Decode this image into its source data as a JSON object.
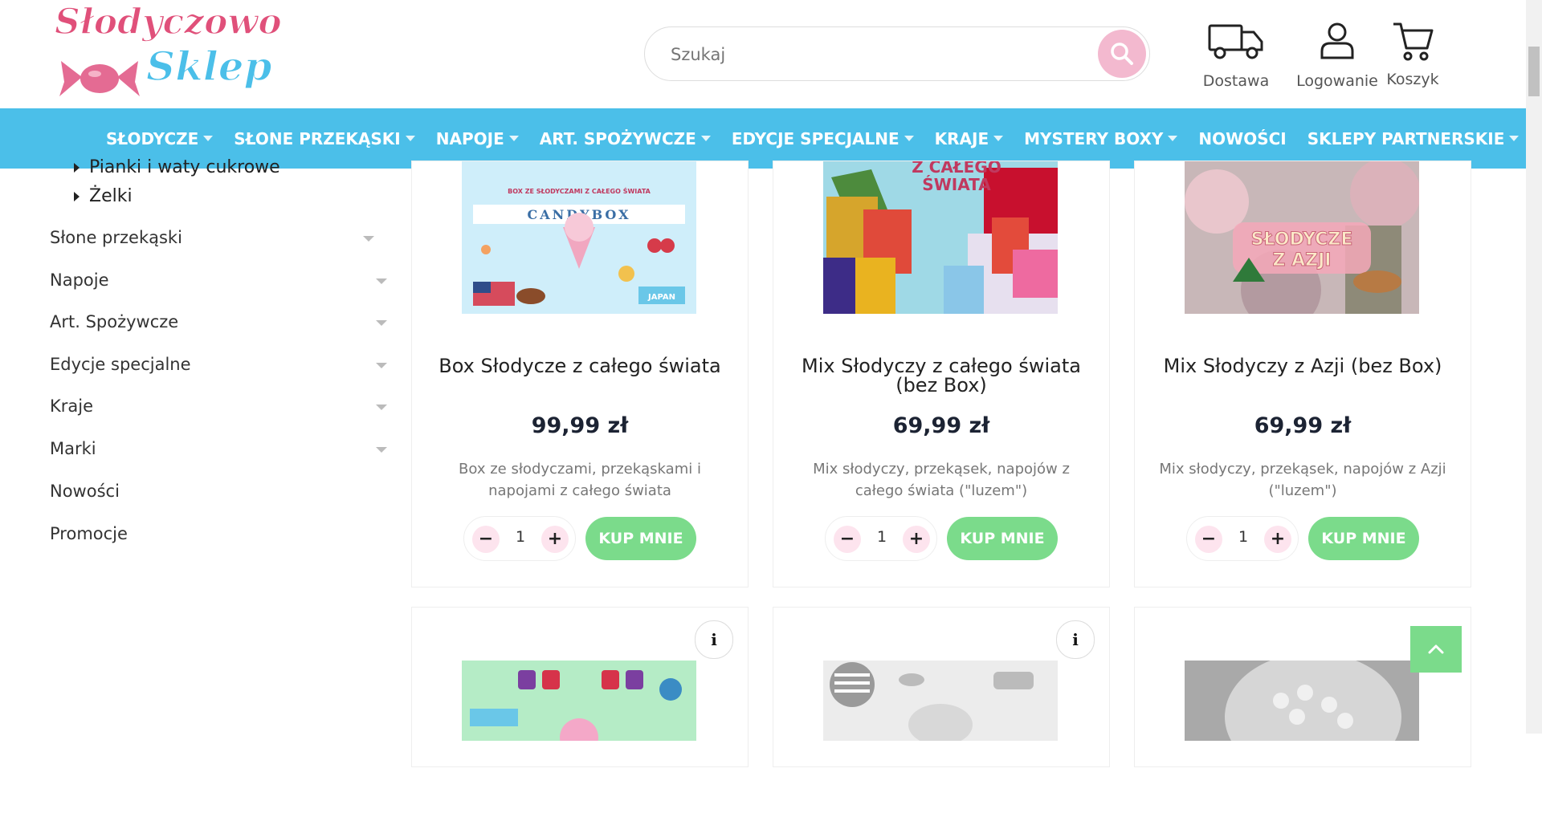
{
  "brand": {
    "line1": "Słodyczowo",
    "line2": "Sklep"
  },
  "search": {
    "placeholder": "Szukaj"
  },
  "header_icons": {
    "delivery": "Dostawa",
    "login": "Logowanie",
    "cart": "Koszyk"
  },
  "nav": [
    {
      "label": "SŁODYCZE",
      "caret": true
    },
    {
      "label": "SŁONE PRZEKĄSKI",
      "caret": true
    },
    {
      "label": "NAPOJE",
      "caret": true
    },
    {
      "label": "ART. SPOŻYWCZE",
      "caret": true
    },
    {
      "label": "EDYCJE SPECJALNE",
      "caret": true
    },
    {
      "label": "KRAJE",
      "caret": true
    },
    {
      "label": "MYSTERY BOXY",
      "caret": true
    },
    {
      "label": "NOWOŚCI",
      "caret": false
    },
    {
      "label": "SKLEPY PARTNERSKIE",
      "caret": true
    }
  ],
  "sidebar": {
    "subcategories": [
      "Pianki i waty cukrowe",
      "Żelki"
    ],
    "categories": [
      {
        "label": "Słone przekąski",
        "caret": true
      },
      {
        "label": "Napoje",
        "caret": true
      },
      {
        "label": "Art. Spożywcze",
        "caret": true
      },
      {
        "label": "Edycje specjalne",
        "caret": true
      },
      {
        "label": "Kraje",
        "caret": true
      },
      {
        "label": "Marki",
        "caret": true
      },
      {
        "label": "Nowości",
        "caret": false
      },
      {
        "label": "Promocje",
        "caret": false
      }
    ]
  },
  "products": [
    {
      "title": "Box Słodycze z całego świata",
      "price": "99,99 zł",
      "desc": "Box ze słodyczami, przekąskami i napojami z całego świata",
      "qty": "1",
      "buy": "KUP MNIE",
      "img_text1": "BOX ZE SŁODYCZAMI Z CAŁEGO ŚWIATA",
      "img_text2": "CANDYBOX",
      "img_text3": "JAPAN"
    },
    {
      "title": "Mix Słodyczy z całego świata (bez Box)",
      "price": "69,99 zł",
      "desc": "Mix słodyczy, przekąsek, napojów z całego świata (\"luzem\")",
      "qty": "1",
      "buy": "KUP MNIE",
      "img_text1": "Z CAŁEGO",
      "img_text2": "ŚWIATA"
    },
    {
      "title": "Mix Słodyczy z Azji (bez Box)",
      "price": "69,99 zł",
      "desc": "Mix słodyczy, przekąsek, napojów z Azji (\"luzem\")",
      "qty": "1",
      "buy": "KUP MNIE",
      "img_text1": "SŁODYCZE",
      "img_text2": "Z AZJI"
    }
  ],
  "info_icon": "i",
  "icons": {
    "search": "search-icon",
    "delivery": "truck-icon",
    "login": "user-icon",
    "cart": "cart-icon",
    "info": "info-icon",
    "top": "chevron-up-icon"
  },
  "colors": {
    "nav": "#4bbfe9",
    "buy": "#7bdb8b",
    "qty_btn": "#fde4ee",
    "search_btn": "#f3b9cf",
    "logo_pink": "#e0507a",
    "logo_blue": "#4bbfe9"
  }
}
